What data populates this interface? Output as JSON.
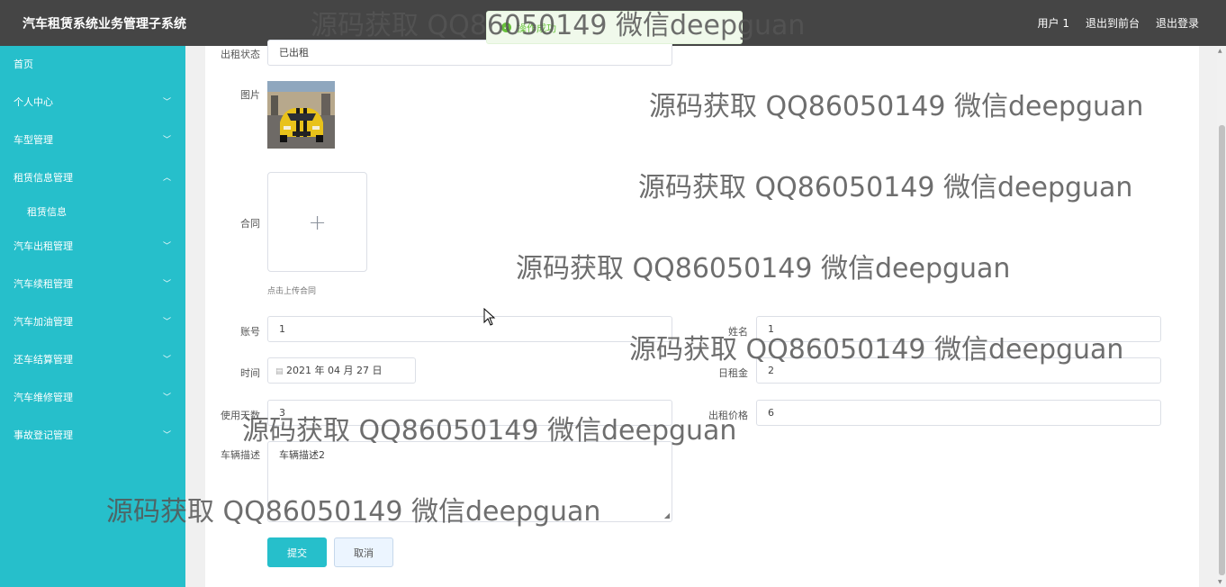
{
  "app": {
    "title": "汽车租赁系统业务管理子系统"
  },
  "header": {
    "user": "用户 1",
    "to_front": "退出到前台",
    "logout": "退出登录"
  },
  "toast": {
    "message": "操作成功"
  },
  "sidebar": {
    "items": [
      {
        "label": "首页",
        "chevron": ""
      },
      {
        "label": "个人中心",
        "chevron": "chevron-down"
      },
      {
        "label": "车型管理",
        "chevron": "chevron-down"
      },
      {
        "label": "租赁信息管理",
        "chevron": "chevron-up"
      },
      {
        "label": "租赁信息",
        "sub": true
      },
      {
        "label": "汽车出租管理",
        "chevron": "chevron-down"
      },
      {
        "label": "汽车续租管理",
        "chevron": "chevron-down"
      },
      {
        "label": "汽车加油管理",
        "chevron": "chevron-down"
      },
      {
        "label": "还车结算管理",
        "chevron": "chevron-down"
      },
      {
        "label": "汽车维修管理",
        "chevron": "chevron-down"
      },
      {
        "label": "事故登记管理",
        "chevron": "chevron-down"
      }
    ]
  },
  "form": {
    "status_label": "出租状态",
    "status_value": "已出租",
    "image_label": "图片",
    "contract_label": "合同",
    "contract_upload_hint": "点击上传合同",
    "account_label": "账号",
    "account_value": "1",
    "name_label": "姓名",
    "name_value": "1",
    "time_label": "时间",
    "time_value": "2021 年 04 月 27 日",
    "daily_rent_label": "日租金",
    "daily_rent_value": "2",
    "days_label": "使用天数",
    "days_value": "3",
    "price_label": "出租价格",
    "price_value": "6",
    "desc_label": "车辆描述",
    "desc_value": "车辆描述2",
    "submit": "提交",
    "cancel": "取消"
  },
  "watermark": {
    "text": "源码获取 QQ86050149 微信deepguan"
  },
  "colors": {
    "header": "#454545",
    "sidebar": "#26bfcb",
    "primary": "#26bfcb"
  }
}
